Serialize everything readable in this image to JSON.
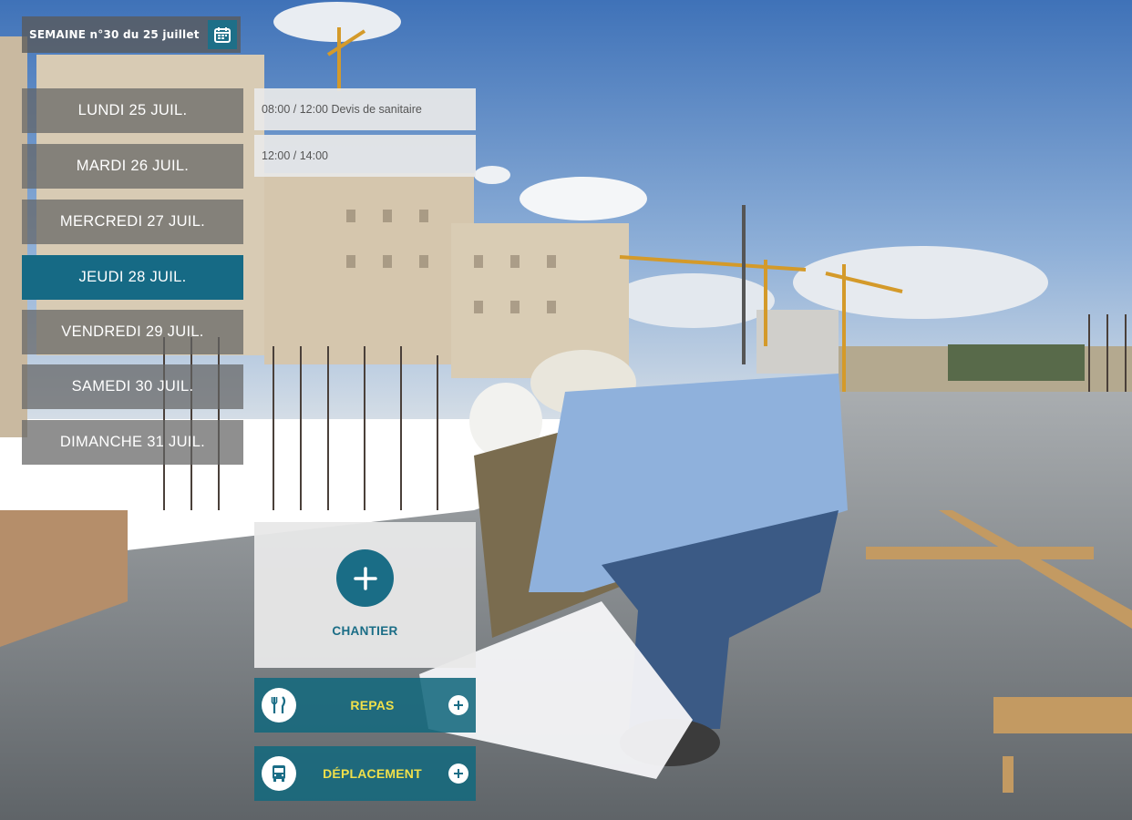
{
  "header": {
    "week_label": "SEMAINE n°30 du 25 juillet"
  },
  "days": [
    {
      "label": "LUNDI 25 JUIL.",
      "active": false
    },
    {
      "label": "MARDI 26 JUIL.",
      "active": false
    },
    {
      "label": "MERCREDI 27 JUIL.",
      "active": false
    },
    {
      "label": "JEUDI 28 JUIL.",
      "active": true
    },
    {
      "label": "VENDREDI 29 JUIL.",
      "active": false
    },
    {
      "label": "SAMEDI 30 JUIL.",
      "active": false
    },
    {
      "label": "DIMANCHE 31 JUIL.",
      "active": false
    }
  ],
  "slots": [
    {
      "label": "08:00 / 12:00 Devis de sanitaire"
    },
    {
      "label": "12:00 / 14:00"
    }
  ],
  "chantier": {
    "label": "CHANTIER"
  },
  "actions": [
    {
      "label": "REPAS",
      "icon": "utensils-icon"
    },
    {
      "label": "DÉPLACEMENT",
      "icon": "bus-icon"
    }
  ],
  "colors": {
    "accent": "#1a6d86",
    "action_text": "#f0e04a",
    "sky": "#5b86c4"
  }
}
